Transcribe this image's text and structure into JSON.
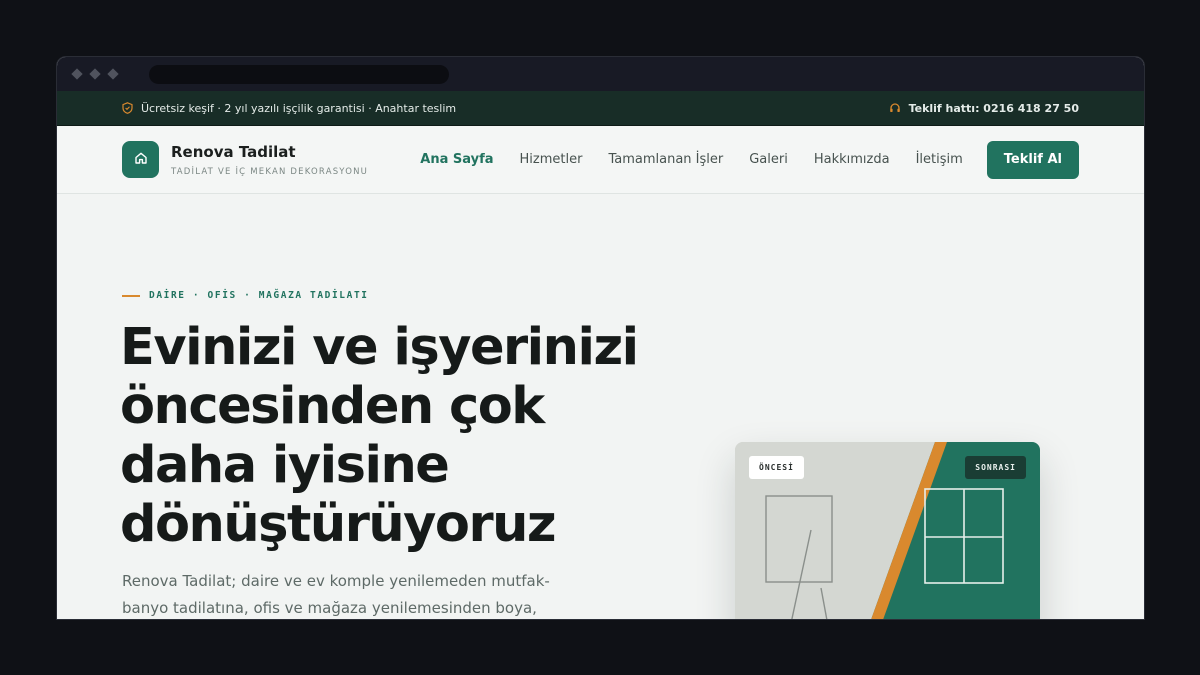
{
  "topbar": {
    "info": "Ücretsiz keşif · 2 yıl yazılı işçilik garantisi · Anahtar teslim",
    "hotline": "Teklif hattı: 0216 418 27 50"
  },
  "brand": {
    "name": "Renova Tadilat",
    "tagline": "TADİLAT VE İÇ MEKAN DEKORASYONU"
  },
  "nav": {
    "items": [
      "Ana Sayfa",
      "Hizmetler",
      "Tamamlanan İşler",
      "Galeri",
      "Hakkımızda",
      "İletişim"
    ],
    "cta": "Teklif Al"
  },
  "hero": {
    "eyebrow": "DAİRE · OFİS · MAĞAZA TADİLATI",
    "headline": "Evinizi ve işyerinizi öncesinden çok daha iyisine dönüştürüyoruz",
    "lead": "Renova Tadilat; daire ve ev komple yenilemeden mutfak-banyo tadilatına, ofis ve mağaza yenilemesinden boya, alçıpan ve",
    "before_label": "ÖNCESİ",
    "after_label": "SONRASI"
  },
  "colors": {
    "accent": "#21735f",
    "dark": "#182d27",
    "orange": "#d9892e"
  }
}
